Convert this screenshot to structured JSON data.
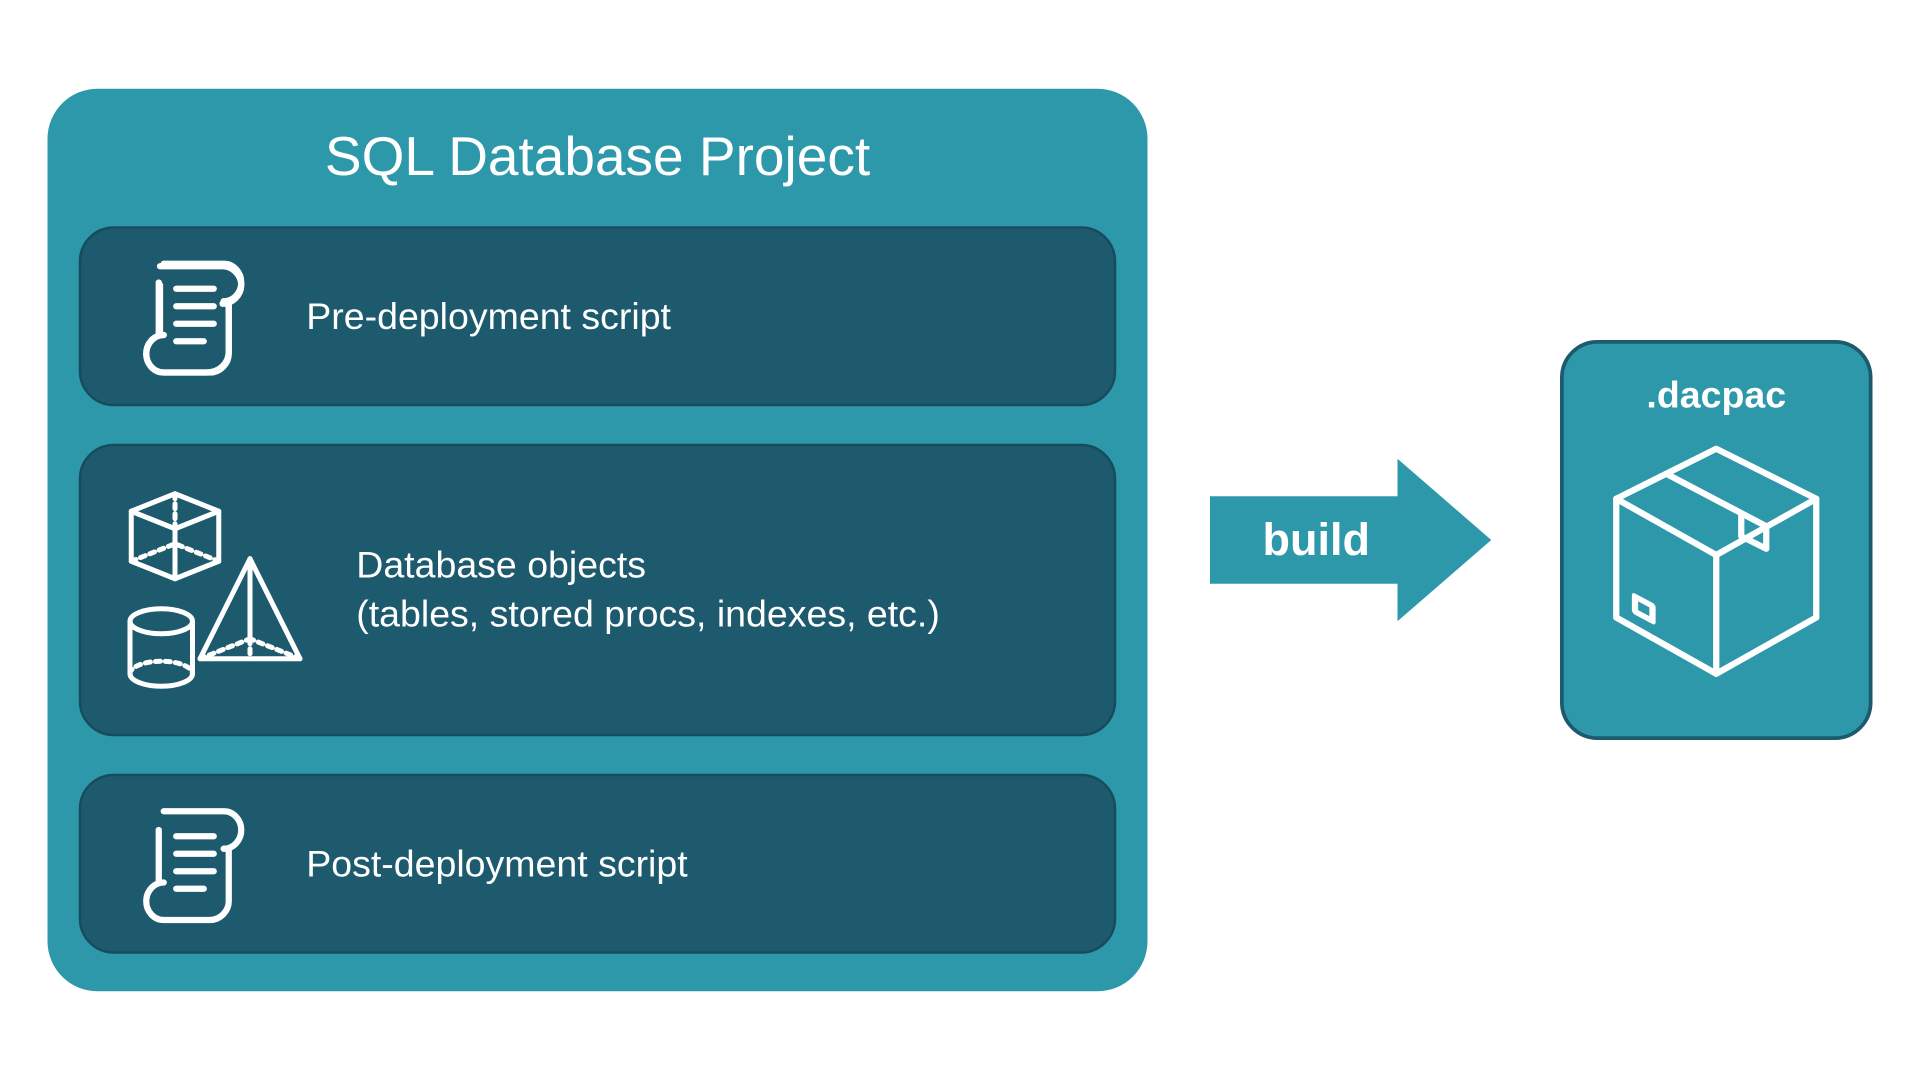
{
  "project": {
    "title": "SQL Database Project",
    "pre_label": "Pre-deployment script",
    "objects_label": "Database objects\n(tables, stored procs, indexes, etc.)",
    "post_label": "Post-deployment script"
  },
  "arrow": {
    "label": "build"
  },
  "output": {
    "label": ".dacpac"
  },
  "colors": {
    "light_teal": "#2e98ab",
    "dark_teal": "#1d5a6e",
    "white": "#ffffff"
  }
}
